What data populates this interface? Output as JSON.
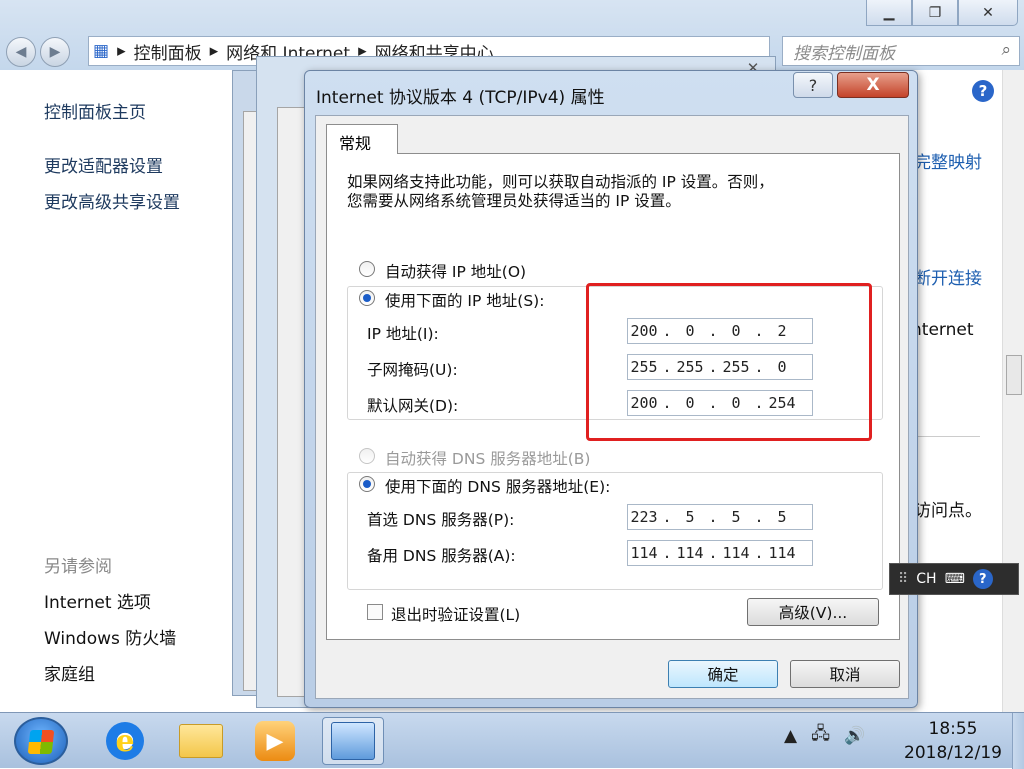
{
  "explorer": {
    "breadcrumb": [
      "控制面板",
      "网络和 Internet",
      "网络和共享中心"
    ],
    "search_placeholder": "搜索控制面板",
    "sidebar": {
      "home": "控制面板主页",
      "links": [
        "更改适配器设置",
        "更改高级共享设置"
      ],
      "see_also_header": "另请参阅",
      "see_also": [
        "Internet 选项",
        "Windows 防火墙",
        "家庭组"
      ]
    },
    "right_fragments": [
      "完整映射",
      "断开连接",
      "Internet",
      "访问点。"
    ]
  },
  "dialog": {
    "title": "Internet 协议版本 4 (TCP/IPv4) 属性",
    "help_btn": "?",
    "close_btn": "X",
    "tab": "常规",
    "description_line1": "如果网络支持此功能，则可以获取自动指派的 IP 设置。否则，",
    "description_line2": "您需要从网络系统管理员处获得适当的 IP 设置。",
    "ip_auto_label": "自动获得 IP 地址(O)",
    "ip_manual_label": "使用下面的 IP 地址(S):",
    "ip_address_label": "IP 地址(I):",
    "ip_address": [
      "200",
      "0",
      "0",
      "2"
    ],
    "subnet_label": "子网掩码(U):",
    "subnet": [
      "255",
      "255",
      "255",
      "0"
    ],
    "gateway_label": "默认网关(D):",
    "gateway": [
      "200",
      "0",
      "0",
      "254"
    ],
    "dns_auto_label": "自动获得 DNS 服务器地址(B)",
    "dns_manual_label": "使用下面的 DNS 服务器地址(E):",
    "dns_pref_label": "首选 DNS 服务器(P):",
    "dns_pref": [
      "223",
      "5",
      "5",
      "5"
    ],
    "dns_alt_label": "备用 DNS 服务器(A):",
    "dns_alt": [
      "114",
      "114",
      "114",
      "114"
    ],
    "validate_label": "退出时验证设置(L)",
    "advanced_btn": "高级(V)...",
    "ok_btn": "确定",
    "cancel_btn": "取消",
    "selected_ip_mode": "manual",
    "selected_dns_mode": "manual",
    "validate_checked": false
  },
  "language_bar": {
    "lang": "CH"
  },
  "taskbar": {
    "time": "18:55",
    "date": "2018/12/19"
  },
  "colors": {
    "highlight": "#e02020",
    "accent": "#1a5cc8"
  }
}
